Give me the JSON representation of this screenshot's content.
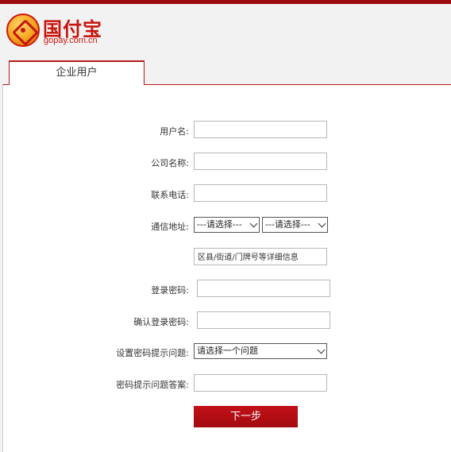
{
  "logo": {
    "text": "国付宝",
    "domain": "gopay.com.cn"
  },
  "tab": {
    "label": "企业用户"
  },
  "form": {
    "username_label": "用户名:",
    "company_label": "公司名称:",
    "phone_label": "联系电话:",
    "address_label": "通信地址:",
    "province_select": "---请选择---",
    "city_select": "---请选择---",
    "address_placeholder": "区县/街道/门牌号等详细信息",
    "password_label": "登录密码:",
    "confirm_label": "确认登录密码:",
    "question_label": "设置密码提示问题:",
    "question_select": "请选择一个问题",
    "answer_label": "密码提示问题答案:",
    "submit": "下一步"
  },
  "colors": {
    "brand": "#9e0b0f",
    "button": "#b10d12"
  }
}
